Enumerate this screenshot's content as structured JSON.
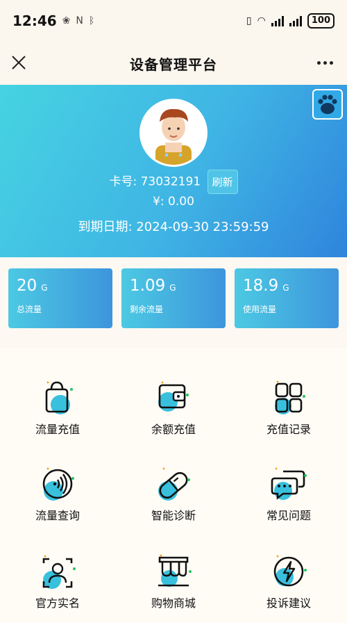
{
  "status_bar": {
    "time": "12:46",
    "battery": "100"
  },
  "nav": {
    "title": "设备管理平台"
  },
  "card": {
    "number_label": "卡号:",
    "number": "73032191",
    "refresh_label": "刷新",
    "balance_label": "¥:",
    "balance": "0.00",
    "expiry_label": "到期日期:",
    "expiry": "2024-09-30 23:59:59"
  },
  "stats": [
    {
      "value": "20",
      "unit": "G",
      "label": "总流量"
    },
    {
      "value": "1.09",
      "unit": "G",
      "label": "剩余流量"
    },
    {
      "value": "18.9",
      "unit": "G",
      "label": "使用流量"
    }
  ],
  "menu": [
    {
      "label": "流量充值",
      "icon": "shopping-bag-icon"
    },
    {
      "label": "余额充值",
      "icon": "wallet-icon"
    },
    {
      "label": "充值记录",
      "icon": "grid-icon"
    },
    {
      "label": "流量查询",
      "icon": "signal-icon"
    },
    {
      "label": "智能诊断",
      "icon": "capsule-icon"
    },
    {
      "label": "常见问题",
      "icon": "chat-bubble-icon"
    },
    {
      "label": "官方实名",
      "icon": "id-scan-icon"
    },
    {
      "label": "购物商城",
      "icon": "shop-icon"
    },
    {
      "label": "投诉建议",
      "icon": "lightning-icon"
    }
  ],
  "colors": {
    "accent": "#3fb4e4",
    "accent_dark": "#2f84dc",
    "icon_fill": "#39c0dd",
    "icon_dot": "#22c55e"
  }
}
